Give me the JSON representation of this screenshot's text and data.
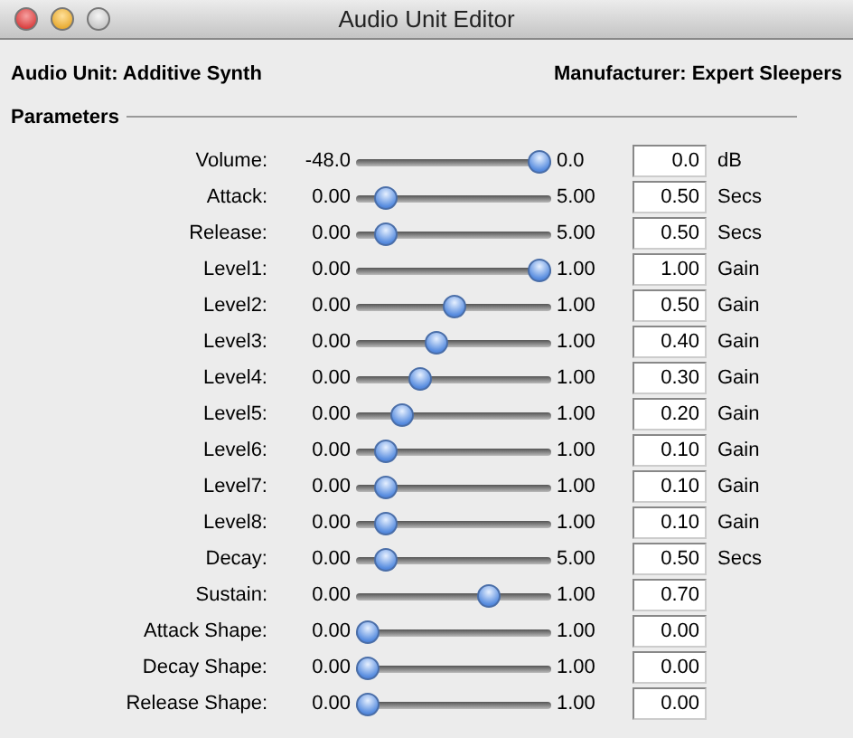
{
  "window": {
    "title": "Audio Unit Editor"
  },
  "audio_unit": "Audio Unit: Additive Synth",
  "manufacturer": "Manufacturer: Expert Sleepers",
  "section": "Parameters",
  "parameters": [
    {
      "label": "Volume:",
      "min": "-48.0",
      "max": "0.0",
      "level": 1.0,
      "value": "0.0",
      "unit": "dB"
    },
    {
      "label": "Attack:",
      "min": "0.00",
      "max": "5.00",
      "level": 0.1,
      "value": "0.50",
      "unit": "Secs"
    },
    {
      "label": "Release:",
      "min": "0.00",
      "max": "5.00",
      "level": 0.1,
      "value": "0.50",
      "unit": "Secs"
    },
    {
      "label": "Level1:",
      "min": "0.00",
      "max": "1.00",
      "level": 1.0,
      "value": "1.00",
      "unit": "Gain"
    },
    {
      "label": "Level2:",
      "min": "0.00",
      "max": "1.00",
      "level": 0.5,
      "value": "0.50",
      "unit": "Gain"
    },
    {
      "label": "Level3:",
      "min": "0.00",
      "max": "1.00",
      "level": 0.4,
      "value": "0.40",
      "unit": "Gain"
    },
    {
      "label": "Level4:",
      "min": "0.00",
      "max": "1.00",
      "level": 0.3,
      "value": "0.30",
      "unit": "Gain"
    },
    {
      "label": "Level5:",
      "min": "0.00",
      "max": "1.00",
      "level": 0.2,
      "value": "0.20",
      "unit": "Gain"
    },
    {
      "label": "Level6:",
      "min": "0.00",
      "max": "1.00",
      "level": 0.1,
      "value": "0.10",
      "unit": "Gain"
    },
    {
      "label": "Level7:",
      "min": "0.00",
      "max": "1.00",
      "level": 0.1,
      "value": "0.10",
      "unit": "Gain"
    },
    {
      "label": "Level8:",
      "min": "0.00",
      "max": "1.00",
      "level": 0.1,
      "value": "0.10",
      "unit": "Gain"
    },
    {
      "label": "Decay:",
      "min": "0.00",
      "max": "5.00",
      "level": 0.1,
      "value": "0.50",
      "unit": "Secs"
    },
    {
      "label": "Sustain:",
      "min": "0.00",
      "max": "1.00",
      "level": 0.7,
      "value": "0.70"
    },
    {
      "label": "Attack Shape:",
      "min": "0.00",
      "max": "1.00",
      "level": 0.0,
      "value": "0.00"
    },
    {
      "label": "Decay Shape:",
      "min": "0.00",
      "max": "1.00",
      "level": 0.0,
      "value": "0.00"
    },
    {
      "label": "Release Shape:",
      "min": "0.00",
      "max": "1.00",
      "level": 0.0,
      "value": "0.00"
    }
  ]
}
